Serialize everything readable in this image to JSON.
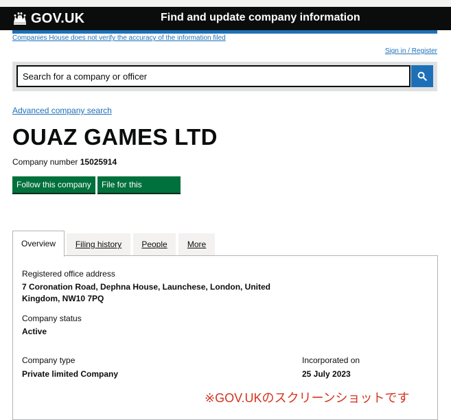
{
  "header": {
    "logo_text": "GOV.UK",
    "service_name": "Find and update company information"
  },
  "disclaimer": "Companies House does not verify the accuracy of the information filed",
  "signin": "Sign in / Register",
  "search": {
    "placeholder": "Search for a company or officer",
    "button_icon": "search-icon"
  },
  "advanced_search": "Advanced company search",
  "company": {
    "name": "OUAZ GAMES LTD",
    "number_label": "Company number",
    "number": "15025914"
  },
  "actions": {
    "follow": "Follow this company",
    "file": "File for this company"
  },
  "tabs": [
    {
      "label": "Overview",
      "active": true
    },
    {
      "label": "Filing history",
      "active": false
    },
    {
      "label": "People",
      "active": false
    },
    {
      "label": "More",
      "active": false
    }
  ],
  "overview": {
    "address_label": "Registered office address",
    "address_line1": "7 Coronation Road, Dephna House, Launchese, London, United",
    "address_line2": "Kingdom, NW10 7PQ",
    "status_label": "Company status",
    "status": "Active",
    "type_label": "Company type",
    "type": "Private limited Company",
    "incorporated_label": "Incorporated on",
    "incorporated": "25 July 2023"
  },
  "note": "※GOV.UKのスクリーンショットです",
  "colors": {
    "header_bg": "#0b0c0c",
    "link": "#1d70b8",
    "button_green": "#00703c",
    "note_red": "#d4351c"
  }
}
